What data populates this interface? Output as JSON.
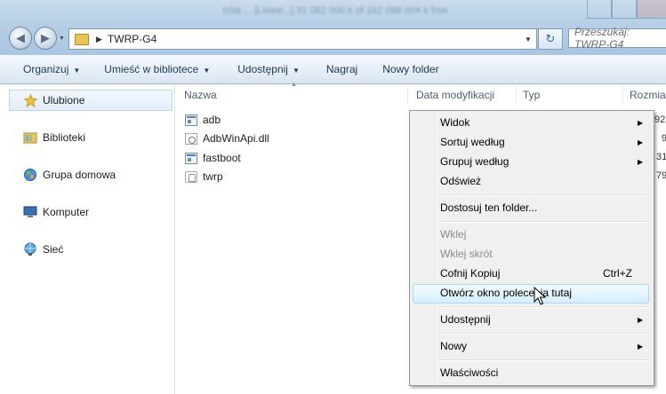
{
  "window": {
    "blurred_title": "Izba ... [Liwee...] 31 082 000 k of 162 098 004 k free"
  },
  "address_bar": {
    "path": "TWRP-G4",
    "search_placeholder": "Przeszukaj: TWRP-G4"
  },
  "command_bar": {
    "items": [
      "Organizuj",
      "Umieść w bibliotece",
      "Udostępnij",
      "Nagraj",
      "Nowy folder"
    ]
  },
  "nav_pane": {
    "favorites": "Ulubione",
    "libraries": "Biblioteki",
    "homegroup": "Grupa domowa",
    "computer": "Komputer",
    "network": "Sieć"
  },
  "columns": {
    "name": "Nazwa",
    "date": "Data modyfikacji",
    "type": "Typ",
    "size": "Rozmiar"
  },
  "files": [
    {
      "name": "adb",
      "size": "92"
    },
    {
      "name": "AdbWinApi.dll",
      "size": "9"
    },
    {
      "name": "fastboot",
      "size": "31"
    },
    {
      "name": "twrp",
      "size": "79"
    }
  ],
  "context_menu": {
    "view": "Widok",
    "sort_by": "Sortuj według",
    "group_by": "Grupuj według",
    "refresh": "Odśwież",
    "customize": "Dostosuj ten folder...",
    "paste": "Wklej",
    "paste_shortcut": "Wklej skrót",
    "undo": "Cofnij Kopiuj",
    "undo_shortcut": "Ctrl+Z",
    "open_cmd": "Otwórz okno polecenia tutaj",
    "share": "Udostępnij",
    "new": "Nowy",
    "properties": "Właściwości"
  },
  "colors": {
    "menu_highlight": "#d6eefb",
    "menu_highlight_border": "#a8d8f4",
    "command_text": "#1e3956"
  }
}
